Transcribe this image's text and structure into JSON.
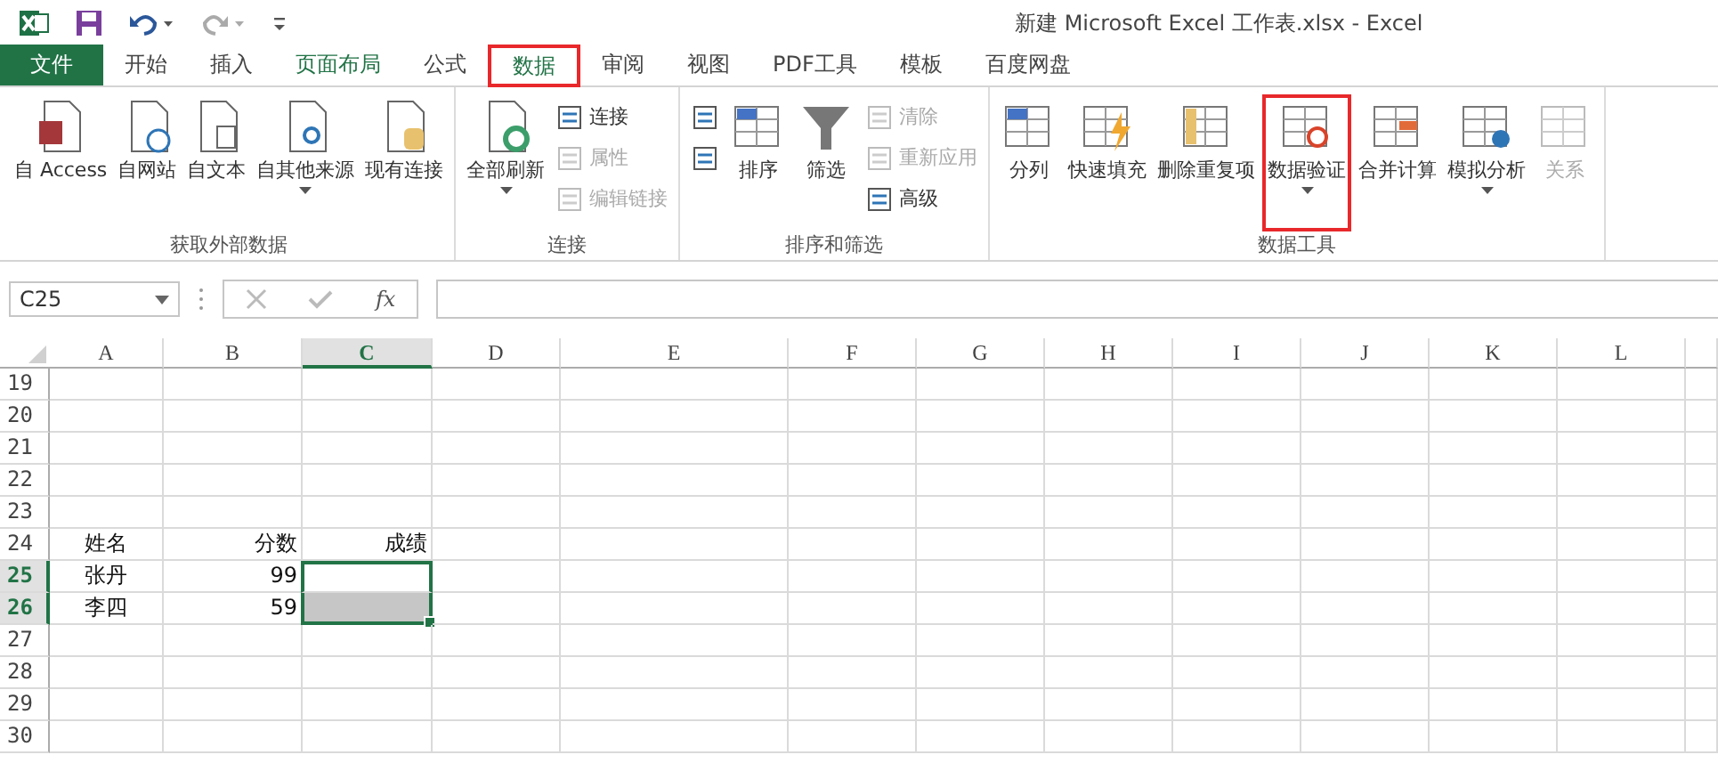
{
  "window": {
    "title": "新建 Microsoft Excel 工作表.xlsx - Excel"
  },
  "tabs": [
    {
      "label": "文件",
      "selected": false,
      "kind": "file",
      "highlighted": false
    },
    {
      "label": "开始",
      "selected": false,
      "kind": "tab",
      "highlighted": false
    },
    {
      "label": "插入",
      "selected": false,
      "kind": "tab",
      "highlighted": false
    },
    {
      "label": "页面布局",
      "selected": false,
      "kind": "tab",
      "highlighted": false
    },
    {
      "label": "公式",
      "selected": false,
      "kind": "tab",
      "highlighted": false
    },
    {
      "label": "数据",
      "selected": true,
      "kind": "tab",
      "highlighted": true
    },
    {
      "label": "审阅",
      "selected": false,
      "kind": "tab",
      "highlighted": false
    },
    {
      "label": "视图",
      "selected": false,
      "kind": "tab",
      "highlighted": false
    },
    {
      "label": "PDF工具",
      "selected": false,
      "kind": "tab",
      "highlighted": false
    },
    {
      "label": "模板",
      "selected": false,
      "kind": "tab",
      "highlighted": false
    },
    {
      "label": "百度网盘",
      "selected": false,
      "kind": "tab",
      "highlighted": false
    }
  ],
  "ribbon_groups": [
    {
      "label": "获取外部数据",
      "columns": [
        {
          "kind": "large",
          "items": [
            {
              "label": "自 Access",
              "disabled": false,
              "dropdown": false,
              "highlighted": false
            }
          ]
        },
        {
          "kind": "large",
          "items": [
            {
              "label": "自网站",
              "disabled": false,
              "dropdown": false,
              "highlighted": false
            }
          ]
        },
        {
          "kind": "large",
          "items": [
            {
              "label": "自文本",
              "disabled": false,
              "dropdown": false,
              "highlighted": false
            }
          ]
        },
        {
          "kind": "large",
          "items": [
            {
              "label": "自其他来源",
              "disabled": false,
              "dropdown": true,
              "highlighted": false
            }
          ]
        },
        {
          "kind": "large",
          "items": [
            {
              "label": "现有连接",
              "disabled": false,
              "dropdown": false,
              "highlighted": false
            }
          ]
        }
      ]
    },
    {
      "label": "连接",
      "columns": [
        {
          "kind": "large",
          "items": [
            {
              "label": "全部刷新",
              "disabled": false,
              "dropdown": true,
              "highlighted": false
            }
          ]
        },
        {
          "kind": "stack",
          "items": [
            {
              "label": "连接",
              "disabled": false
            },
            {
              "label": "属性",
              "disabled": true
            },
            {
              "label": "编辑链接",
              "disabled": true
            }
          ]
        }
      ]
    },
    {
      "label": "排序和筛选",
      "columns": [
        {
          "kind": "stack",
          "items": [
            {
              "disabled": false
            },
            {
              "disabled": false
            }
          ]
        },
        {
          "kind": "large",
          "items": [
            {
              "label": "排序",
              "disabled": false,
              "dropdown": false,
              "highlighted": false
            }
          ]
        },
        {
          "kind": "large",
          "items": [
            {
              "label": "筛选",
              "disabled": false,
              "dropdown": false,
              "highlighted": false
            }
          ]
        },
        {
          "kind": "stack",
          "items": [
            {
              "label": "清除",
              "disabled": true
            },
            {
              "label": "重新应用",
              "disabled": true
            },
            {
              "label": "高级",
              "disabled": false
            }
          ]
        }
      ]
    },
    {
      "label": "数据工具",
      "columns": [
        {
          "kind": "large",
          "items": [
            {
              "label": "分列",
              "disabled": false,
              "dropdown": false,
              "highlighted": false
            }
          ]
        },
        {
          "kind": "large",
          "items": [
            {
              "label": "快速填充",
              "disabled": false,
              "dropdown": false,
              "highlighted": false
            }
          ]
        },
        {
          "kind": "large",
          "items": [
            {
              "label": "删除重复项",
              "disabled": false,
              "dropdown": false,
              "highlighted": false
            }
          ]
        },
        {
          "kind": "large",
          "items": [
            {
              "label": "数据验证",
              "disabled": false,
              "dropdown": true,
              "highlighted": true
            }
          ]
        },
        {
          "kind": "large",
          "items": [
            {
              "label": "合并计算",
              "disabled": false,
              "dropdown": false,
              "highlighted": false
            }
          ]
        },
        {
          "kind": "large",
          "items": [
            {
              "label": "模拟分析",
              "disabled": false,
              "dropdown": true,
              "highlighted": false
            }
          ]
        },
        {
          "kind": "large",
          "items": [
            {
              "label": "关系",
              "disabled": true,
              "dropdown": false,
              "highlighted": false
            }
          ]
        }
      ]
    }
  ],
  "formula_bar": {
    "name_box": "C25",
    "function_label": "fx"
  },
  "sheet": {
    "columns": [
      {
        "label": "A",
        "selected": false
      },
      {
        "label": "B",
        "selected": false
      },
      {
        "label": "C",
        "selected": true
      },
      {
        "label": "D",
        "selected": false
      },
      {
        "label": "E",
        "selected": false
      },
      {
        "label": "F",
        "selected": false
      },
      {
        "label": "G",
        "selected": false
      },
      {
        "label": "H",
        "selected": false
      },
      {
        "label": "I",
        "selected": false
      },
      {
        "label": "J",
        "selected": false
      },
      {
        "label": "K",
        "selected": false
      },
      {
        "label": "L",
        "selected": false
      }
    ],
    "rows": [
      {
        "number": "19",
        "selected": false,
        "cells": []
      },
      {
        "number": "20",
        "selected": false,
        "cells": []
      },
      {
        "number": "21",
        "selected": false,
        "cells": []
      },
      {
        "number": "22",
        "selected": false,
        "cells": []
      },
      {
        "number": "23",
        "selected": false,
        "cells": []
      },
      {
        "number": "24",
        "selected": false,
        "cells": [
          {
            "text": "姓名",
            "shaded": false
          },
          {
            "text": "分数",
            "shaded": false
          },
          {
            "text": "成绩",
            "shaded": false
          }
        ]
      },
      {
        "number": "25",
        "selected": true,
        "cells": [
          {
            "text": "张丹",
            "shaded": false
          },
          {
            "text": "99",
            "shaded": false
          },
          {
            "shaded": false
          }
        ]
      },
      {
        "number": "26",
        "selected": true,
        "cells": [
          {
            "text": "李四",
            "shaded": false
          },
          {
            "text": "59",
            "shaded": false
          },
          {
            "shaded": true
          }
        ]
      },
      {
        "number": "27",
        "selected": false,
        "cells": []
      },
      {
        "number": "28",
        "selected": false,
        "cells": []
      },
      {
        "number": "29",
        "selected": false,
        "cells": []
      },
      {
        "number": "30",
        "selected": false,
        "cells": []
      }
    ]
  }
}
